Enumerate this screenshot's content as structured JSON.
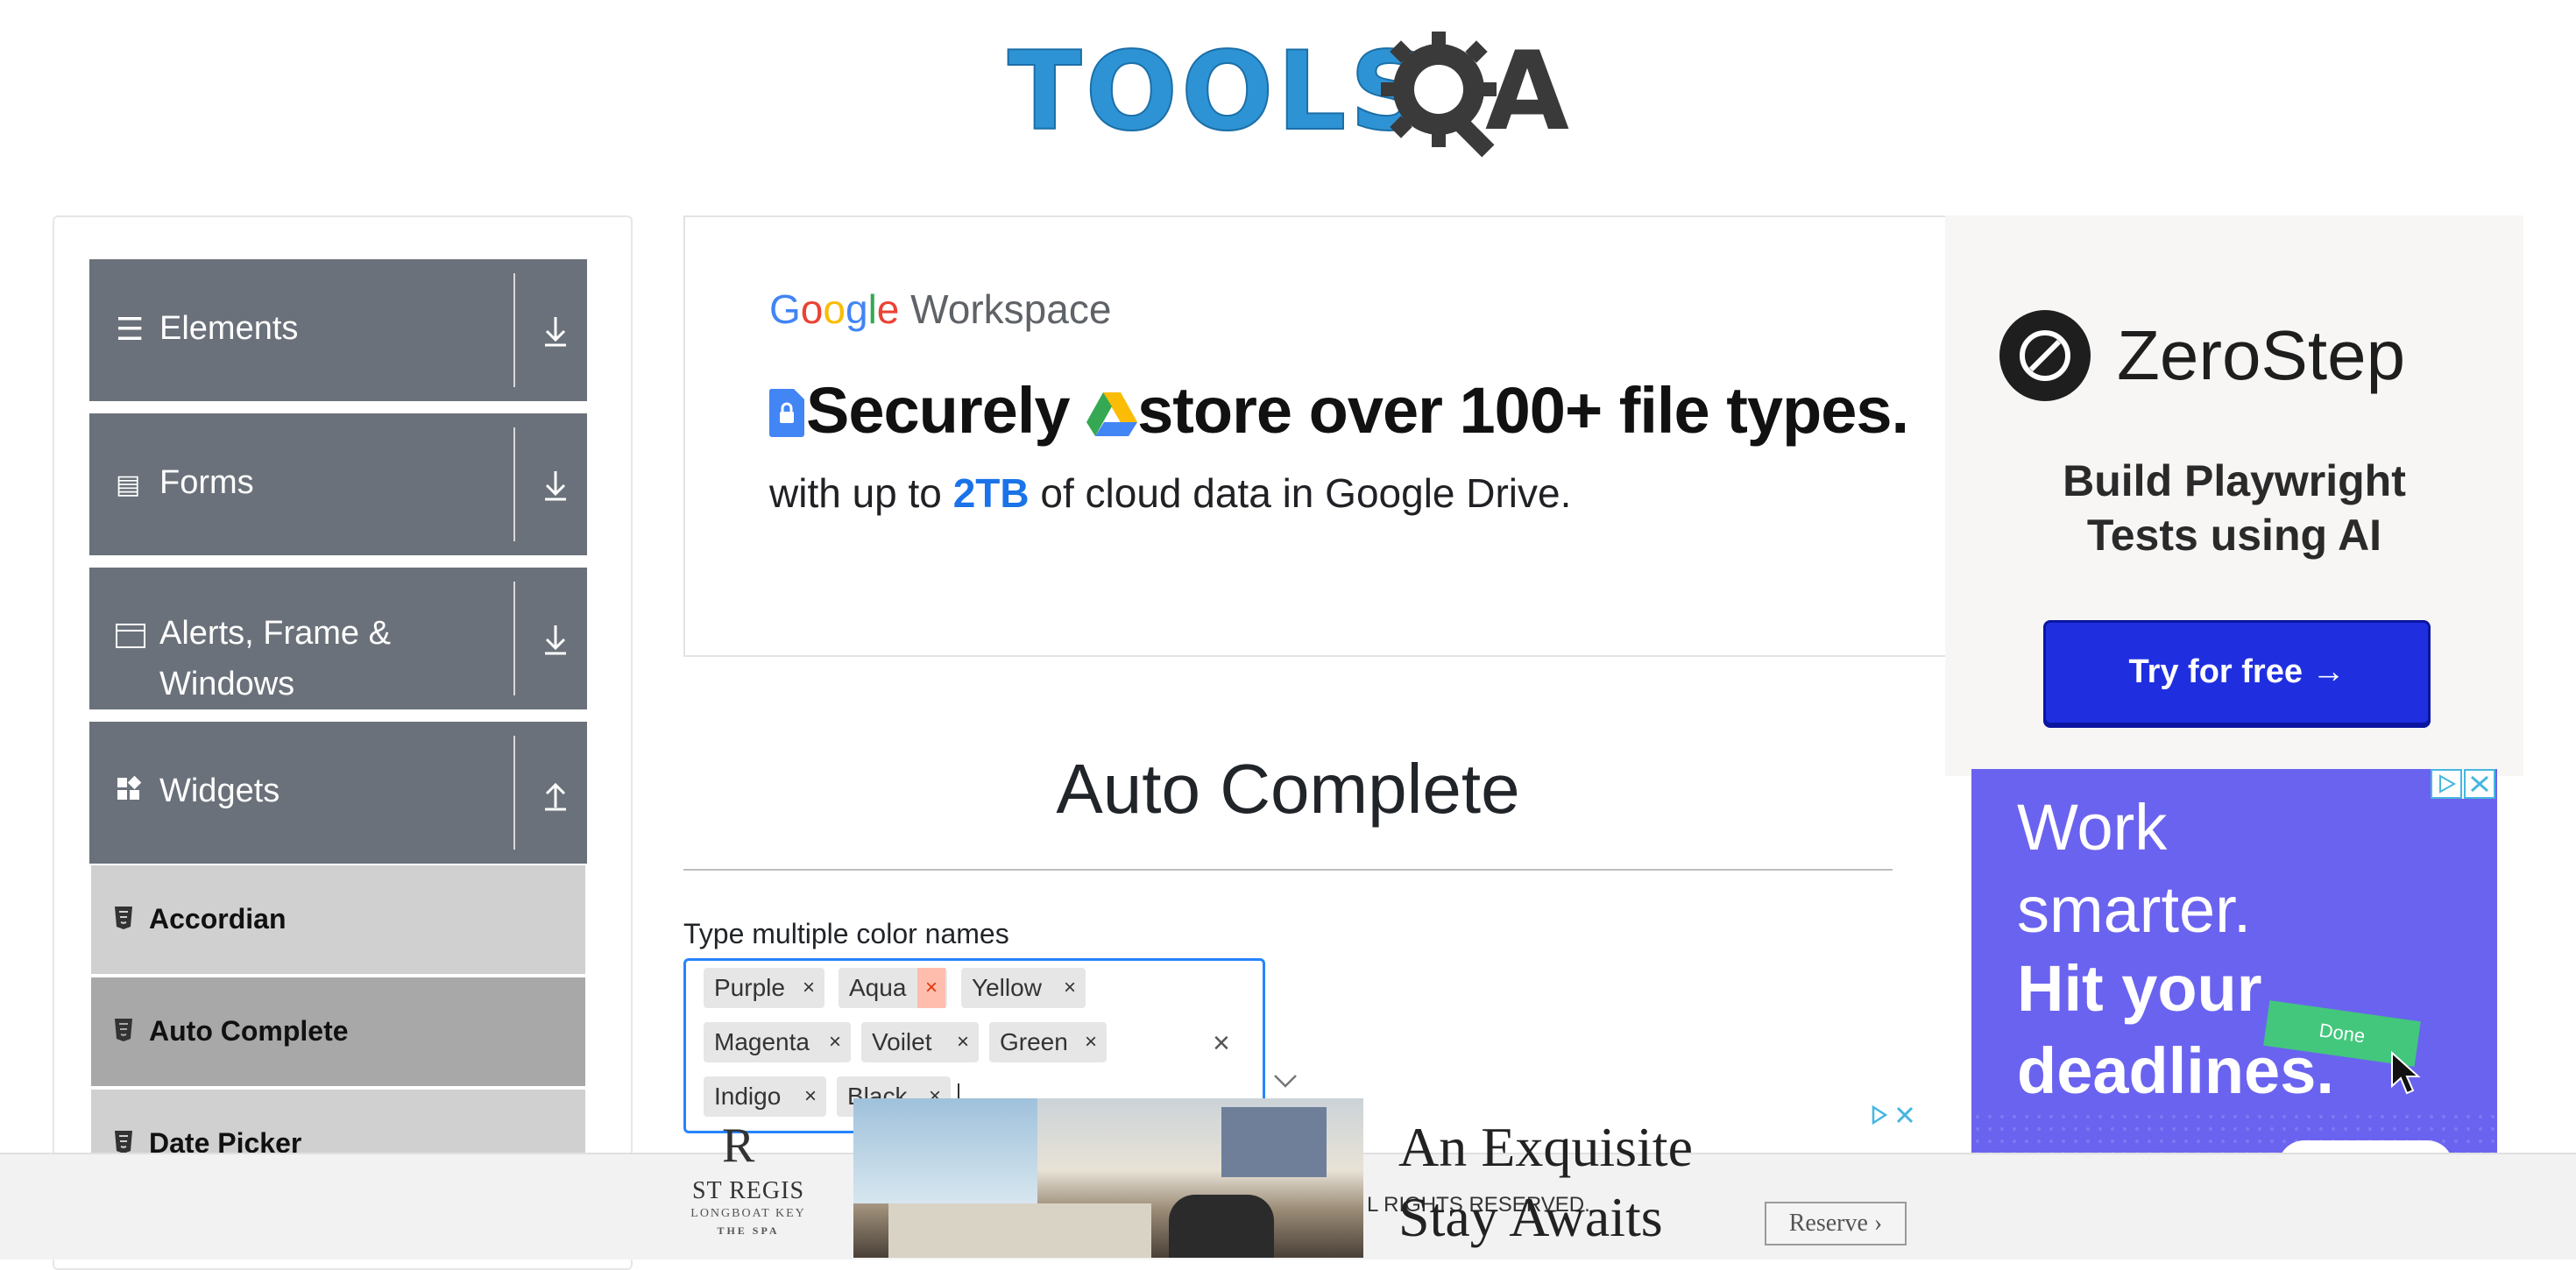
{
  "header": {
    "logo_text_tools": "TOOLS",
    "logo_text_a": "A"
  },
  "sidebar": {
    "groups": [
      {
        "label": "Elements",
        "icon": "hamburger-icon"
      },
      {
        "label": "Forms",
        "icon": "document-icon"
      },
      {
        "label": "Alerts, Frame & Windows",
        "icon": "window-icon"
      },
      {
        "label": "Widgets",
        "icon": "widgets-icon"
      }
    ],
    "items": [
      {
        "label": "Accordian"
      },
      {
        "label": "Auto Complete"
      },
      {
        "label": "Date Picker"
      }
    ]
  },
  "ads": {
    "google": {
      "brand": "Workspace",
      "headline_a": "Securely ",
      "headline_b": "store over 100+ file types.",
      "sub_a": "with up to ",
      "sub_hl": "2TB",
      "sub_b": " of cloud data in Google Drive."
    },
    "zerostep": {
      "name": "ZeroStep",
      "tagline_1": "Build Playwright",
      "tagline_2": "Tests using AI",
      "button": "Try for free →"
    },
    "work": {
      "line1": "Work",
      "line2": "smarter.",
      "line3": "Hit your",
      "line4": "deadlines.",
      "done": "Done"
    },
    "bottom": {
      "brand_monogram": "R",
      "brand_name": "ST REGIS",
      "brand_location": "LONGBOAT KEY",
      "brand_sub": "THE SPA",
      "headline_1": "An Exquisite",
      "headline_2": "Stay Awaits",
      "cta": "Reserve"
    }
  },
  "main": {
    "title": "Auto Complete",
    "field_label": "Type multiple color names",
    "chips_row1": [
      "Purple",
      "Aqua",
      "Yellow"
    ],
    "chips_row2": [
      "Magenta",
      "Voilet",
      "Green"
    ],
    "chips_row3": [
      "Indigo",
      "Black"
    ],
    "remove_glyph": "×"
  },
  "footer": {
    "text": "L RIGHTS RESERVED."
  },
  "colors": {
    "sidebar_group": "#6b717a",
    "focus_border": "#2684ff",
    "chip_bg": "#e6e6e6",
    "chip_remove_hover": "#ffbdad"
  }
}
